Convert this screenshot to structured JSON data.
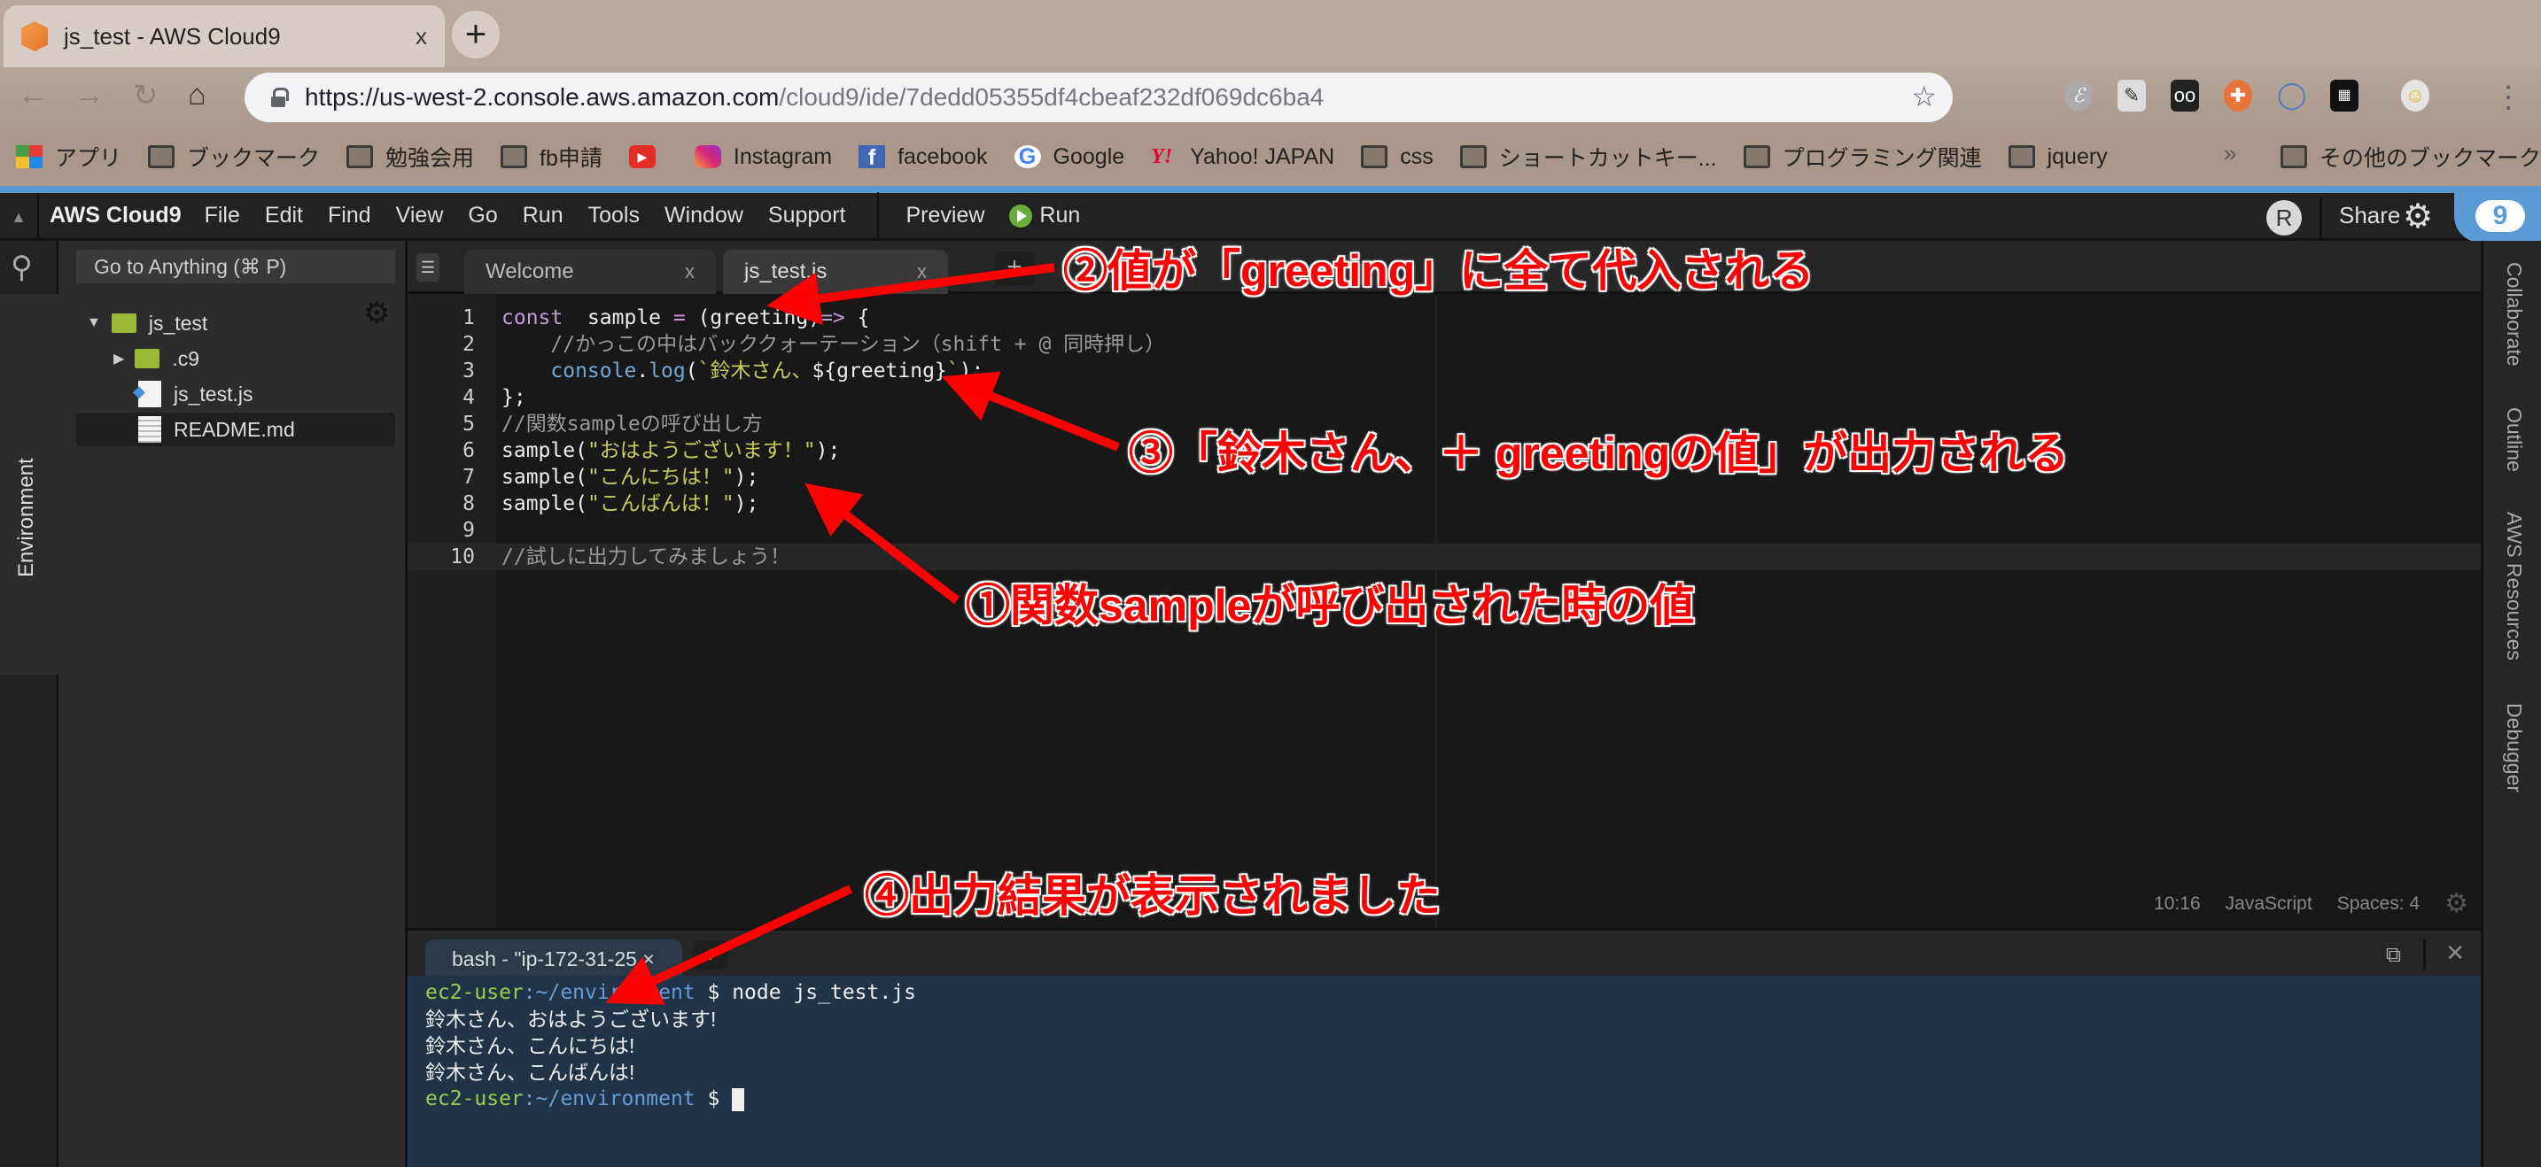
{
  "browser": {
    "tab_title": "js_test - AWS Cloud9",
    "tab_close": "x",
    "new_tab": "+",
    "url_host": "https://us-west-2.console.aws.amazon.com",
    "url_path": "/cloud9/ide/7dedd05355df4cbeaf232df069dc6ba4",
    "bookmarks": [
      {
        "label": "アプリ",
        "icon": "apps-grid-icon"
      },
      {
        "label": "ブックマーク",
        "icon": "folder-icon"
      },
      {
        "label": "勉強会用",
        "icon": "folder-icon"
      },
      {
        "label": "fb申請",
        "icon": "folder-icon"
      },
      {
        "label": "",
        "icon": "youtube-icon"
      },
      {
        "label": "Instagram",
        "icon": "instagram-icon"
      },
      {
        "label": "facebook",
        "icon": "facebook-icon"
      },
      {
        "label": "Google",
        "icon": "google-icon"
      },
      {
        "label": "Yahoo! JAPAN",
        "icon": "yahoo-icon"
      },
      {
        "label": "css",
        "icon": "folder-icon"
      },
      {
        "label": "ショートカットキー...",
        "icon": "folder-icon"
      },
      {
        "label": "プログラミング関連",
        "icon": "folder-icon"
      },
      {
        "label": "jquery",
        "icon": "folder-icon"
      }
    ],
    "bookmarks_more": "»",
    "other_bookmarks": "その他のブックマーク"
  },
  "ide": {
    "brand": "AWS Cloud9",
    "menu": [
      "File",
      "Edit",
      "Find",
      "View",
      "Go",
      "Run",
      "Tools",
      "Window",
      "Support"
    ],
    "preview": "Preview",
    "run": "Run",
    "avatar_initial": "R",
    "share": "Share",
    "goto_placeholder": "Go to Anything (⌘ P)",
    "env_tab": "Environment",
    "tree": {
      "root": "js_test",
      "children": [
        ".c9",
        "js_test.js",
        "README.md"
      ]
    },
    "tabs": [
      {
        "label": "Welcome",
        "close": "x"
      },
      {
        "label": "js_test.js",
        "close": "x"
      }
    ],
    "add_tab": "+",
    "code_lines": [
      {
        "n": "1",
        "parts": [
          [
            "k",
            "const"
          ],
          [
            "",
            "  sample "
          ],
          [
            "k",
            "="
          ],
          [
            "",
            " (greeting)"
          ],
          [
            "k",
            "=>"
          ],
          [
            "",
            " {"
          ]
        ]
      },
      {
        "n": "2",
        "parts": [
          [
            "c",
            "    //かっこの中はバッククォーテーション（shift + @ 同時押し）"
          ]
        ]
      },
      {
        "n": "3",
        "parts": [
          [
            "f",
            "    console"
          ],
          [
            "",
            "."
          ],
          [
            "f",
            "log"
          ],
          [
            "",
            "("
          ],
          [
            "s",
            "`鈴木さん、"
          ],
          [
            "",
            "${greeting}"
          ],
          [
            "s",
            "`"
          ],
          [
            "",
            ");"
          ]
        ]
      },
      {
        "n": "4",
        "parts": [
          [
            "",
            "};"
          ]
        ]
      },
      {
        "n": "5",
        "parts": [
          [
            "c",
            "//関数sampleの呼び出し方"
          ]
        ]
      },
      {
        "n": "6",
        "parts": [
          [
            "",
            "sample("
          ],
          [
            "s",
            "\"おはようございます！\""
          ],
          [
            "",
            ");"
          ]
        ]
      },
      {
        "n": "7",
        "parts": [
          [
            "",
            "sample("
          ],
          [
            "s",
            "\"こんにちは！\""
          ],
          [
            "",
            ");"
          ]
        ]
      },
      {
        "n": "8",
        "parts": [
          [
            "",
            "sample("
          ],
          [
            "s",
            "\"こんばんは！\""
          ],
          [
            "",
            ");"
          ]
        ]
      },
      {
        "n": "9",
        "parts": []
      },
      {
        "n": "10",
        "parts": [
          [
            "c",
            "//試しに出力してみましょう！"
          ]
        ]
      }
    ],
    "status": {
      "position": "10:16",
      "language": "JavaScript",
      "spaces": "Spaces: 4"
    },
    "terminal_tab": "bash - \"ip-172-31-25",
    "terminal_tab_close": "×",
    "terminal_add": "+",
    "terminal": {
      "prompt_user": "ec2-user",
      "prompt_path": ":~/environment",
      "prompt_symbol": " $ ",
      "command": "node js_test.js",
      "outputs": [
        "鈴木さん、おはようございます!",
        "鈴木さん、こんにちは!",
        "鈴木さん、こんばんは!"
      ]
    },
    "right_tabs": [
      "Collaborate",
      "Outline",
      "AWS Resources",
      "Debugger"
    ]
  },
  "annotations": {
    "a1": "①関数sampleが呼び出された時の値",
    "a2": "②値が「greeting」に全て代入される",
    "a3": "③「鈴木さん、＋ greetingの値」が出力される",
    "a4": "④出力結果が表示されました"
  }
}
